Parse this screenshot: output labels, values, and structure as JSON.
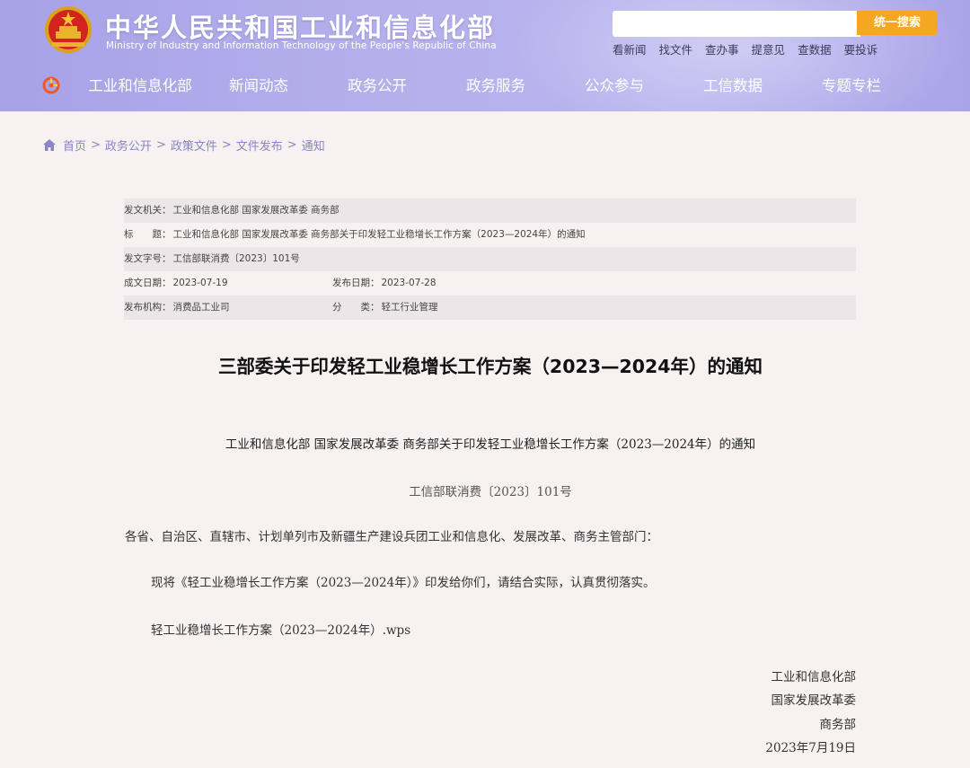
{
  "header": {
    "title": "中华人民共和国工业和信息化部",
    "subtitle": "Ministry of Industry and Information Technology of the People's Republic of China",
    "search_placeholder": "",
    "search_button": "统一搜索",
    "quick_links": [
      "看新闻",
      "找文件",
      "查办事",
      "提意见",
      "查数据",
      "要投诉"
    ],
    "nav": [
      "工业和信息化部",
      "新闻动态",
      "政务公开",
      "政务服务",
      "公众参与",
      "工信数据",
      "专题专栏"
    ]
  },
  "breadcrumb": [
    "首页",
    "政务公开",
    "政策文件",
    "文件发布",
    "通知"
  ],
  "meta": {
    "issuer_label": "发文机关：",
    "issuer": "工业和信息化部 国家发展改革委 商务部",
    "title_label": "标　　题：",
    "title": "工业和信息化部 国家发展改革委 商务部关于印发轻工业稳增长工作方案（2023—2024年）的通知",
    "docno_label": "发文字号：",
    "docno": "工信部联消费〔2023〕101号",
    "created_label": "成文日期：",
    "created": "2023-07-19",
    "published_label": "发布日期：",
    "published": "2023-07-28",
    "org_label": "发布机构：",
    "org": "消费品工业司",
    "category_label": "分　　类：",
    "category": "轻工行业管理"
  },
  "article": {
    "title": "三部委关于印发轻工业稳增长工作方案（2023—2024年）的通知",
    "subtitle": "工业和信息化部 国家发展改革委 商务部关于印发轻工业稳增长工作方案（2023—2024年）的通知",
    "doc_no": "工信部联消费〔2023〕101号",
    "addressee": "各省、自治区、直辖市、计划单列市及新疆生产建设兵团工业和信息化、发展改革、商务主管部门：",
    "body": "现将《轻工业稳增长工作方案（2023—2024年）》印发给你们，请结合实际，认真贯彻落实。",
    "attachment": "轻工业稳增长工作方案（2023—2024年）.wps",
    "signatures": [
      "工业和信息化部",
      "国家发展改革委",
      "商务部",
      "2023年7月19日"
    ]
  },
  "colors": {
    "header_bg": "#b5b0ec",
    "search_button": "#f5a623",
    "breadcrumb": "#8a84c8",
    "page_bg": "#f7f1f1"
  }
}
